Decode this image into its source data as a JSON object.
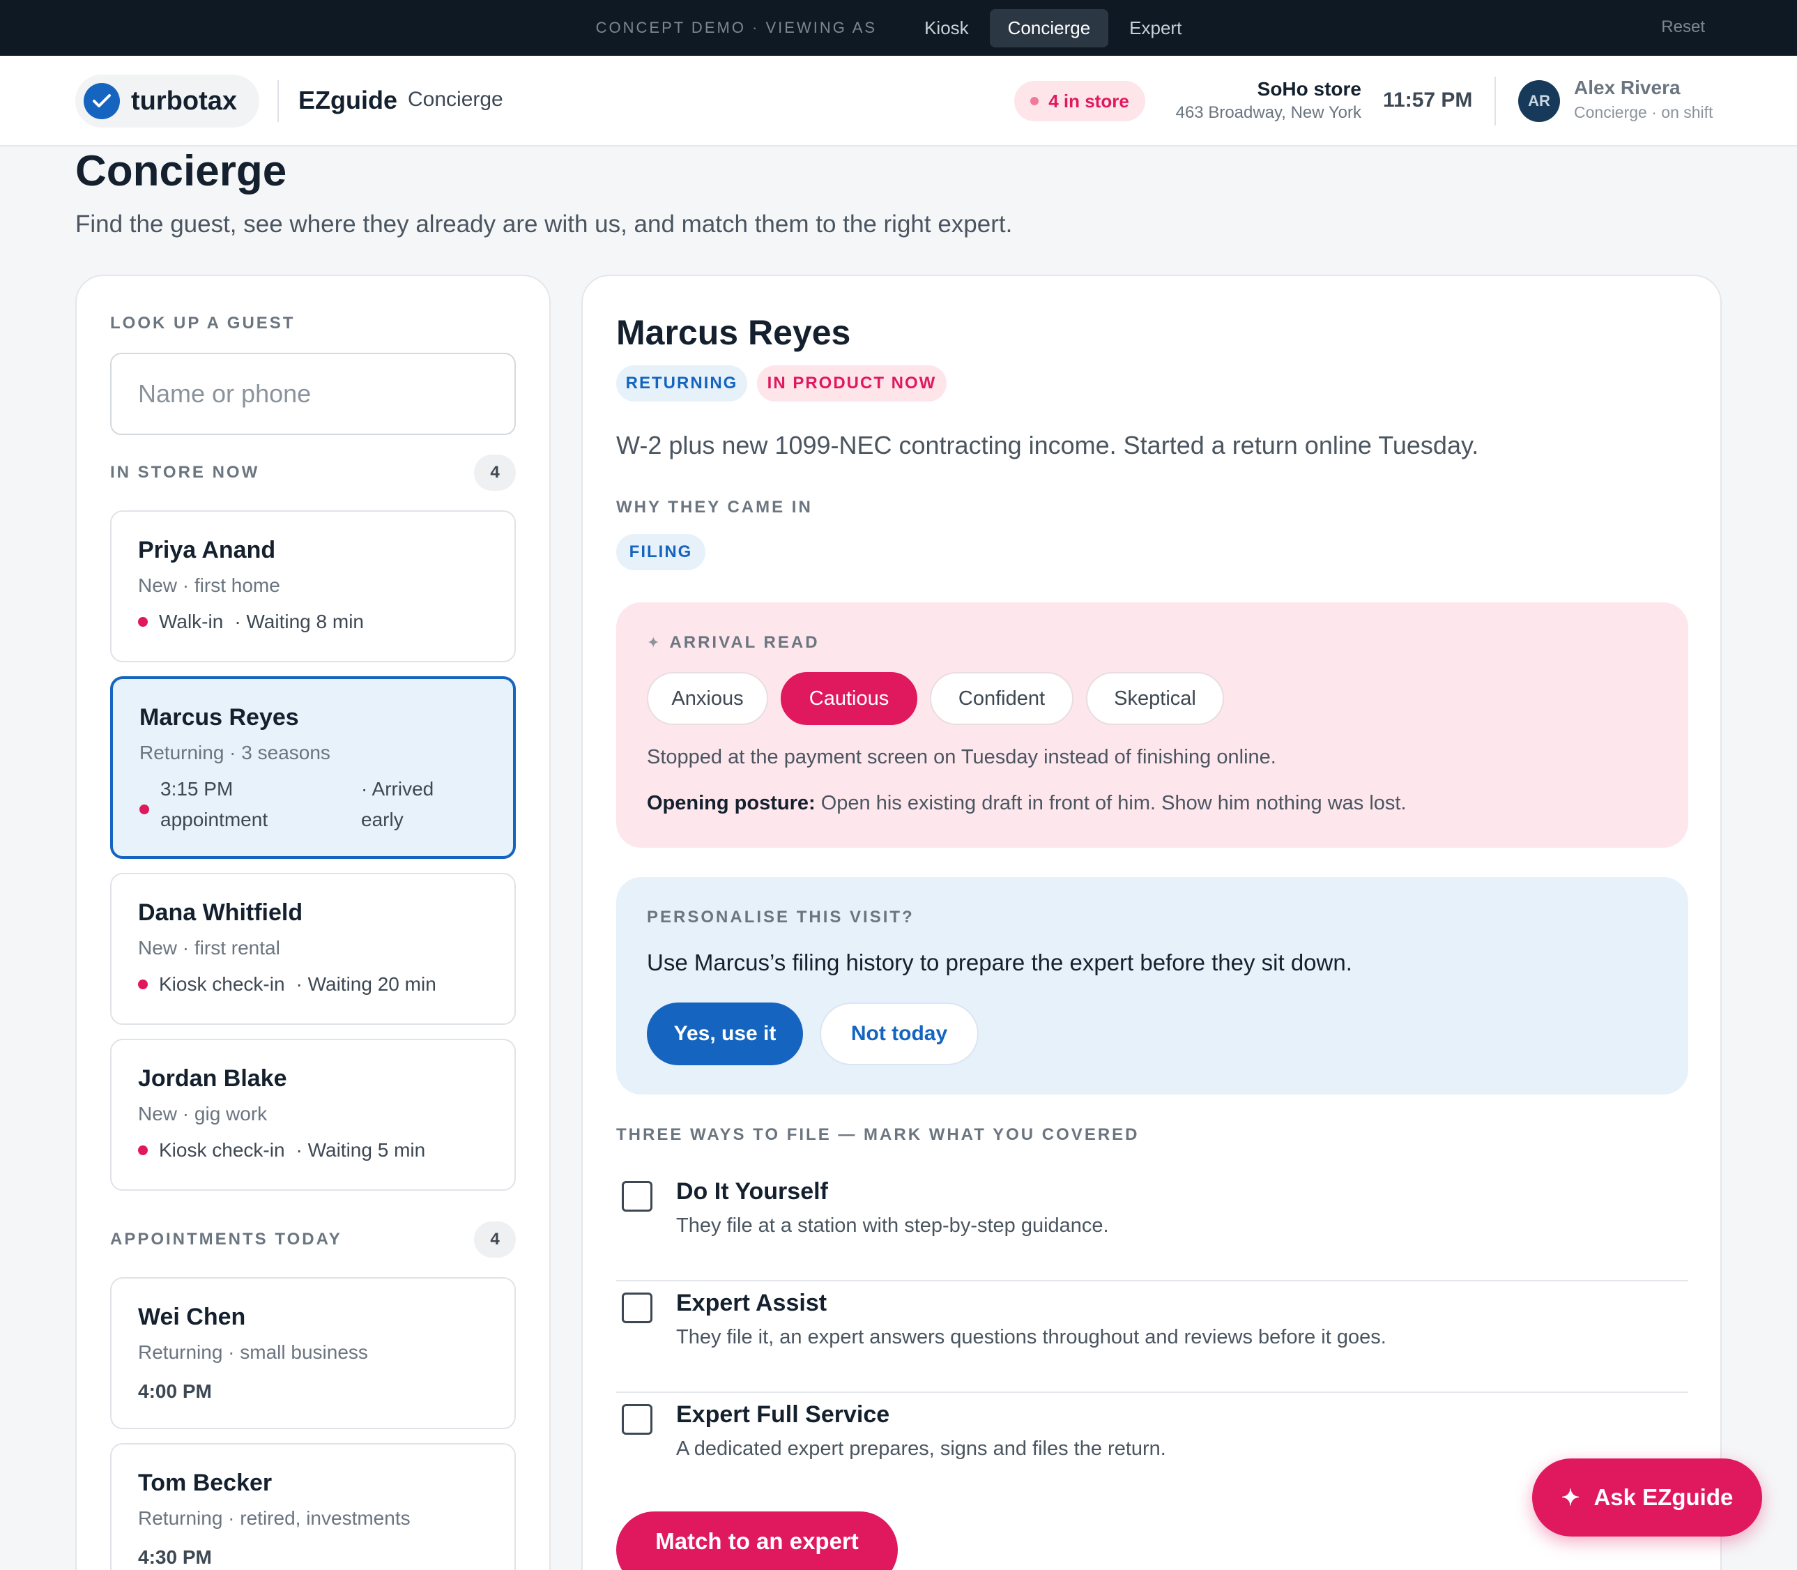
{
  "demo_bar": {
    "label": "CONCEPT DEMO · VIEWING AS",
    "tabs": [
      {
        "label": "Kiosk",
        "active": false
      },
      {
        "label": "Concierge",
        "active": true
      },
      {
        "label": "Expert",
        "active": false
      }
    ],
    "reset_label": "Reset"
  },
  "header": {
    "brand": "turbotax",
    "app_name": "EZguide",
    "mode": "Concierge",
    "store_count": "4 in store",
    "store_name": "SoHo store",
    "store_address": "463 Broadway, New York",
    "time": "11:57 PM",
    "user_initials": "AR",
    "user_name": "Alex Rivera",
    "user_role": "Concierge · on shift"
  },
  "page": {
    "title": "Concierge",
    "subtitle": "Find the guest, see where they already are with us, and match them to the right expert."
  },
  "left": {
    "lookup_label": "LOOK UP A GUEST",
    "search_placeholder": "Name or phone",
    "instore_label": "IN STORE NOW",
    "instore_count": "4",
    "instore": [
      {
        "name": "Priya Anand",
        "sub": "New · first home",
        "source": "Walk-in",
        "wait": "· Waiting 8 min"
      },
      {
        "name": "Marcus Reyes",
        "sub": "Returning · 3 seasons",
        "source_l1": "3:15 PM",
        "source_l2": "appointment",
        "wait_l1": "· Arrived",
        "wait_l2": "early"
      },
      {
        "name": "Dana Whitfield",
        "sub": "New · first rental",
        "source": "Kiosk check-in",
        "wait": "· Waiting 20 min"
      },
      {
        "name": "Jordan Blake",
        "sub": "New · gig work",
        "source": "Kiosk check-in",
        "wait": "· Waiting 5 min"
      }
    ],
    "appointments_label": "APPOINTMENTS TODAY",
    "appointments_count": "4",
    "appointments": [
      {
        "name": "Wei Chen",
        "sub": "Returning · small business",
        "time": "4:00 PM"
      },
      {
        "name": "Tom Becker",
        "sub": "Returning · retired, investments",
        "time": "4:30 PM"
      }
    ]
  },
  "detail": {
    "name": "Marcus Reyes",
    "tags": [
      "RETURNING",
      "IN PRODUCT NOW"
    ],
    "summary": "W-2 plus new 1099-NEC contracting income. Started a return online Tuesday.",
    "why_label": "WHY THEY CAME IN",
    "why_tag": "FILING",
    "arrival": {
      "label": "ARRIVAL READ",
      "moods": [
        "Anxious",
        "Cautious",
        "Confident",
        "Skeptical"
      ],
      "selected": "Cautious",
      "note": "Stopped at the payment screen on Tuesday instead of finishing online.",
      "posture_label": "Opening posture:",
      "posture_text": "Open his existing draft in front of him. Show him nothing was lost."
    },
    "personalise": {
      "label": "PERSONALISE THIS VISIT?",
      "text": "Use Marcus’s filing history to prepare the expert before they sit down.",
      "yes": "Yes, use it",
      "no": "Not today"
    },
    "ways_label": "THREE WAYS TO FILE — MARK WHAT YOU COVERED",
    "ways": [
      {
        "title": "Do It Yourself",
        "desc": "They file at a station with step-by-step guidance."
      },
      {
        "title": "Expert Assist",
        "desc": "They file it, an expert answers questions throughout and reviews before it goes."
      },
      {
        "title": "Expert Full Service",
        "desc": "A dedicated expert prepares, signs and files the return."
      }
    ],
    "match_button": "Match to an expert"
  },
  "ask_button": "Ask EZguide",
  "colors": {
    "brand_blue": "#1565c0",
    "accent_pink": "#e0185e",
    "dark_bar": "#0f1923"
  }
}
